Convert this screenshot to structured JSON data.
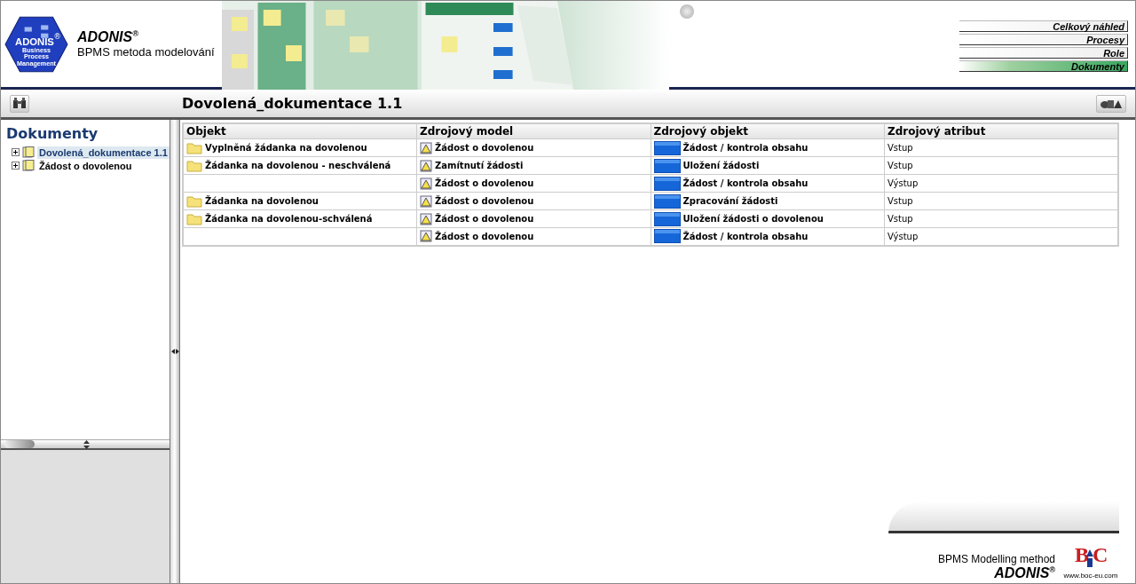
{
  "logo": {
    "name": "ADONIS",
    "registered": "®",
    "tagline": [
      "Business",
      "Process",
      "Management"
    ]
  },
  "header": {
    "brand": "ADONIS$^{®}$",
    "subtitle": "BPMS metoda modelování"
  },
  "nav": [
    {
      "label": "Celkový náhled",
      "selected": false
    },
    {
      "label": "Procesy",
      "selected": false
    },
    {
      "label": "Role",
      "selected": false
    },
    {
      "label": "Dokumenty",
      "selected": true
    }
  ],
  "toolbar": {
    "title": "Dovolená_dokumentace 1.1"
  },
  "sidebar": {
    "title": "Dokumenty",
    "items": [
      {
        "label": "Dovolená_dokumentace 1.1",
        "selected": true,
        "expanded": false
      },
      {
        "label": "Žádost o dovolenou",
        "selected": false,
        "expanded": false
      }
    ]
  },
  "table": {
    "columns": [
      "Objekt",
      "Zdrojový model",
      "Zdrojový objekt",
      "Zdrojový atribut"
    ],
    "rows": [
      {
        "object": "Vyplněná žádanka na dovolenou",
        "model": "Žádost o dovolenou",
        "source": "Žádost / kontrola obsahu",
        "attribute": "Vstup"
      },
      {
        "object": "Žádanka na dovolenou - neschválená",
        "model": "Zamítnutí žádosti",
        "source": "Uložení žádosti",
        "attribute": "Vstup"
      },
      {
        "model": "Žádost o dovolenou",
        "source": "Žádost / kontrola obsahu",
        "attribute": "Výstup"
      },
      {
        "object": "Žádanka na dovolenou",
        "model": "Žádost o dovolenou",
        "source": "Zpracování žádosti",
        "attribute": "Vstup"
      },
      {
        "object": "Žádanka na dovolenou-schválená",
        "model": "Žádost o dovolenou",
        "source": "Uložení žádosti o dovolenou",
        "attribute": "Vstup"
      },
      {
        "model": "Žádost o dovolenou",
        "source": "Žádost / kontrola obsahu",
        "attribute": "Výstup"
      }
    ]
  },
  "footer": {
    "caption": "BPMS Modelling method",
    "brand": "ADONIS$^{®}$",
    "company_logo": {
      "left": "B",
      "right": "C",
      "url": "www.boc-eu.com"
    }
  }
}
